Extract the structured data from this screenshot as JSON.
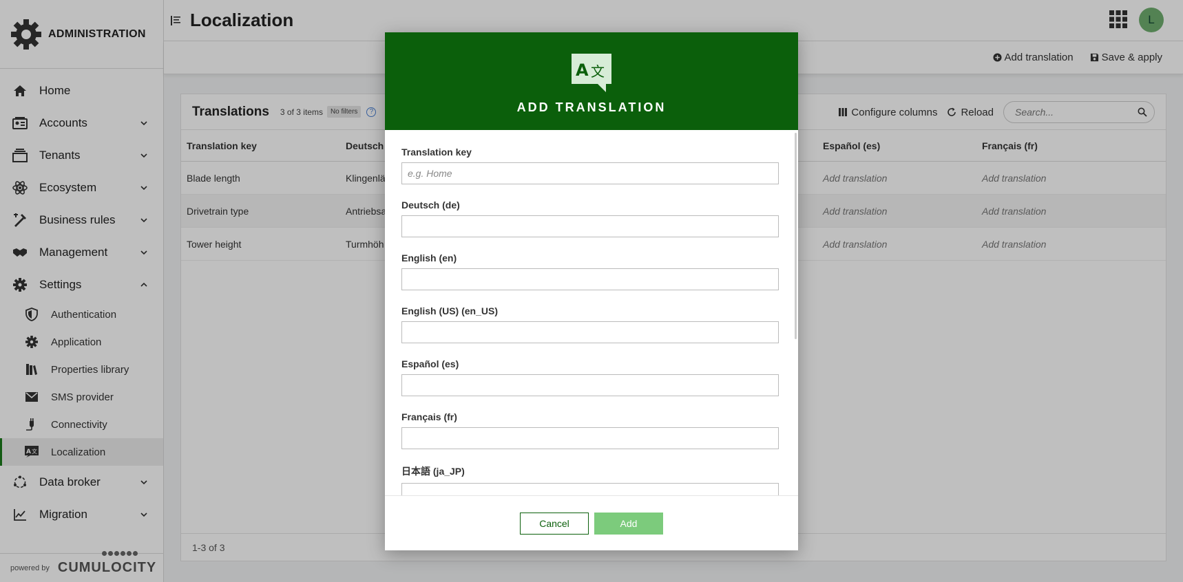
{
  "brand": {
    "title": "ADMINISTRATION"
  },
  "sidebar": {
    "items": [
      {
        "label": "Home",
        "icon": "home-icon"
      },
      {
        "label": "Accounts",
        "icon": "accounts-icon"
      },
      {
        "label": "Tenants",
        "icon": "tenants-icon"
      },
      {
        "label": "Ecosystem",
        "icon": "ecosystem-icon"
      },
      {
        "label": "Business rules",
        "icon": "business-rules-icon"
      },
      {
        "label": "Management",
        "icon": "handshake-icon"
      },
      {
        "label": "Settings",
        "icon": "gear-icon"
      }
    ],
    "settings_sub": [
      {
        "label": "Authentication",
        "icon": "shield-icon"
      },
      {
        "label": "Application",
        "icon": "gear-icon"
      },
      {
        "label": "Properties library",
        "icon": "library-icon"
      },
      {
        "label": "SMS provider",
        "icon": "envelope-icon"
      },
      {
        "label": "Connectivity",
        "icon": "plug-icon"
      },
      {
        "label": "Localization",
        "icon": "translate-icon"
      }
    ],
    "bottom_items": [
      {
        "label": "Data broker",
        "icon": "data-broker-icon"
      },
      {
        "label": "Migration",
        "icon": "chart-line-icon"
      }
    ],
    "powered_by": "powered by",
    "vendor": "CUMULOCITY"
  },
  "header": {
    "title": "Localization",
    "avatar_initial": "L"
  },
  "actionbar": {
    "add_translation": "Add translation",
    "save_apply": "Save & apply"
  },
  "card": {
    "title": "Translations",
    "count": "3 of 3 items",
    "filters_badge": "No filters",
    "help": "?",
    "configure_columns": "Configure columns",
    "reload": "Reload",
    "search_placeholder": "Search...",
    "columns": [
      "Translation key",
      "Deutsch",
      "",
      "",
      "Español (es)",
      "Français (fr)"
    ],
    "rows": [
      [
        "Blade length",
        "Klingenlä",
        "",
        "",
        "Add translation",
        "Add translation"
      ],
      [
        "Drivetrain type",
        "Antriebsa",
        "",
        "",
        "Add translation",
        "Add translation"
      ],
      [
        "Tower height",
        "Turmhöh",
        "",
        "",
        "Add translation",
        "Add translation"
      ]
    ],
    "footer": "1-3 of 3"
  },
  "modal": {
    "title": "ADD TRANSLATION",
    "fields": [
      {
        "label": "Translation key",
        "placeholder": "e.g. Home",
        "value": ""
      },
      {
        "label": "Deutsch (de)",
        "placeholder": "",
        "value": ""
      },
      {
        "label": "English (en)",
        "placeholder": "",
        "value": ""
      },
      {
        "label": "English (US) (en_US)",
        "placeholder": "",
        "value": ""
      },
      {
        "label": "Español (es)",
        "placeholder": "",
        "value": ""
      },
      {
        "label": "Français (fr)",
        "placeholder": "",
        "value": ""
      },
      {
        "label": "日本語 (ja_JP)",
        "placeholder": "",
        "value": ""
      }
    ],
    "cancel": "Cancel",
    "add": "Add"
  },
  "colors": {
    "brand_green": "#0b5f0b",
    "add_button": "#7ccb7c",
    "avatar": "#6fae6f"
  }
}
